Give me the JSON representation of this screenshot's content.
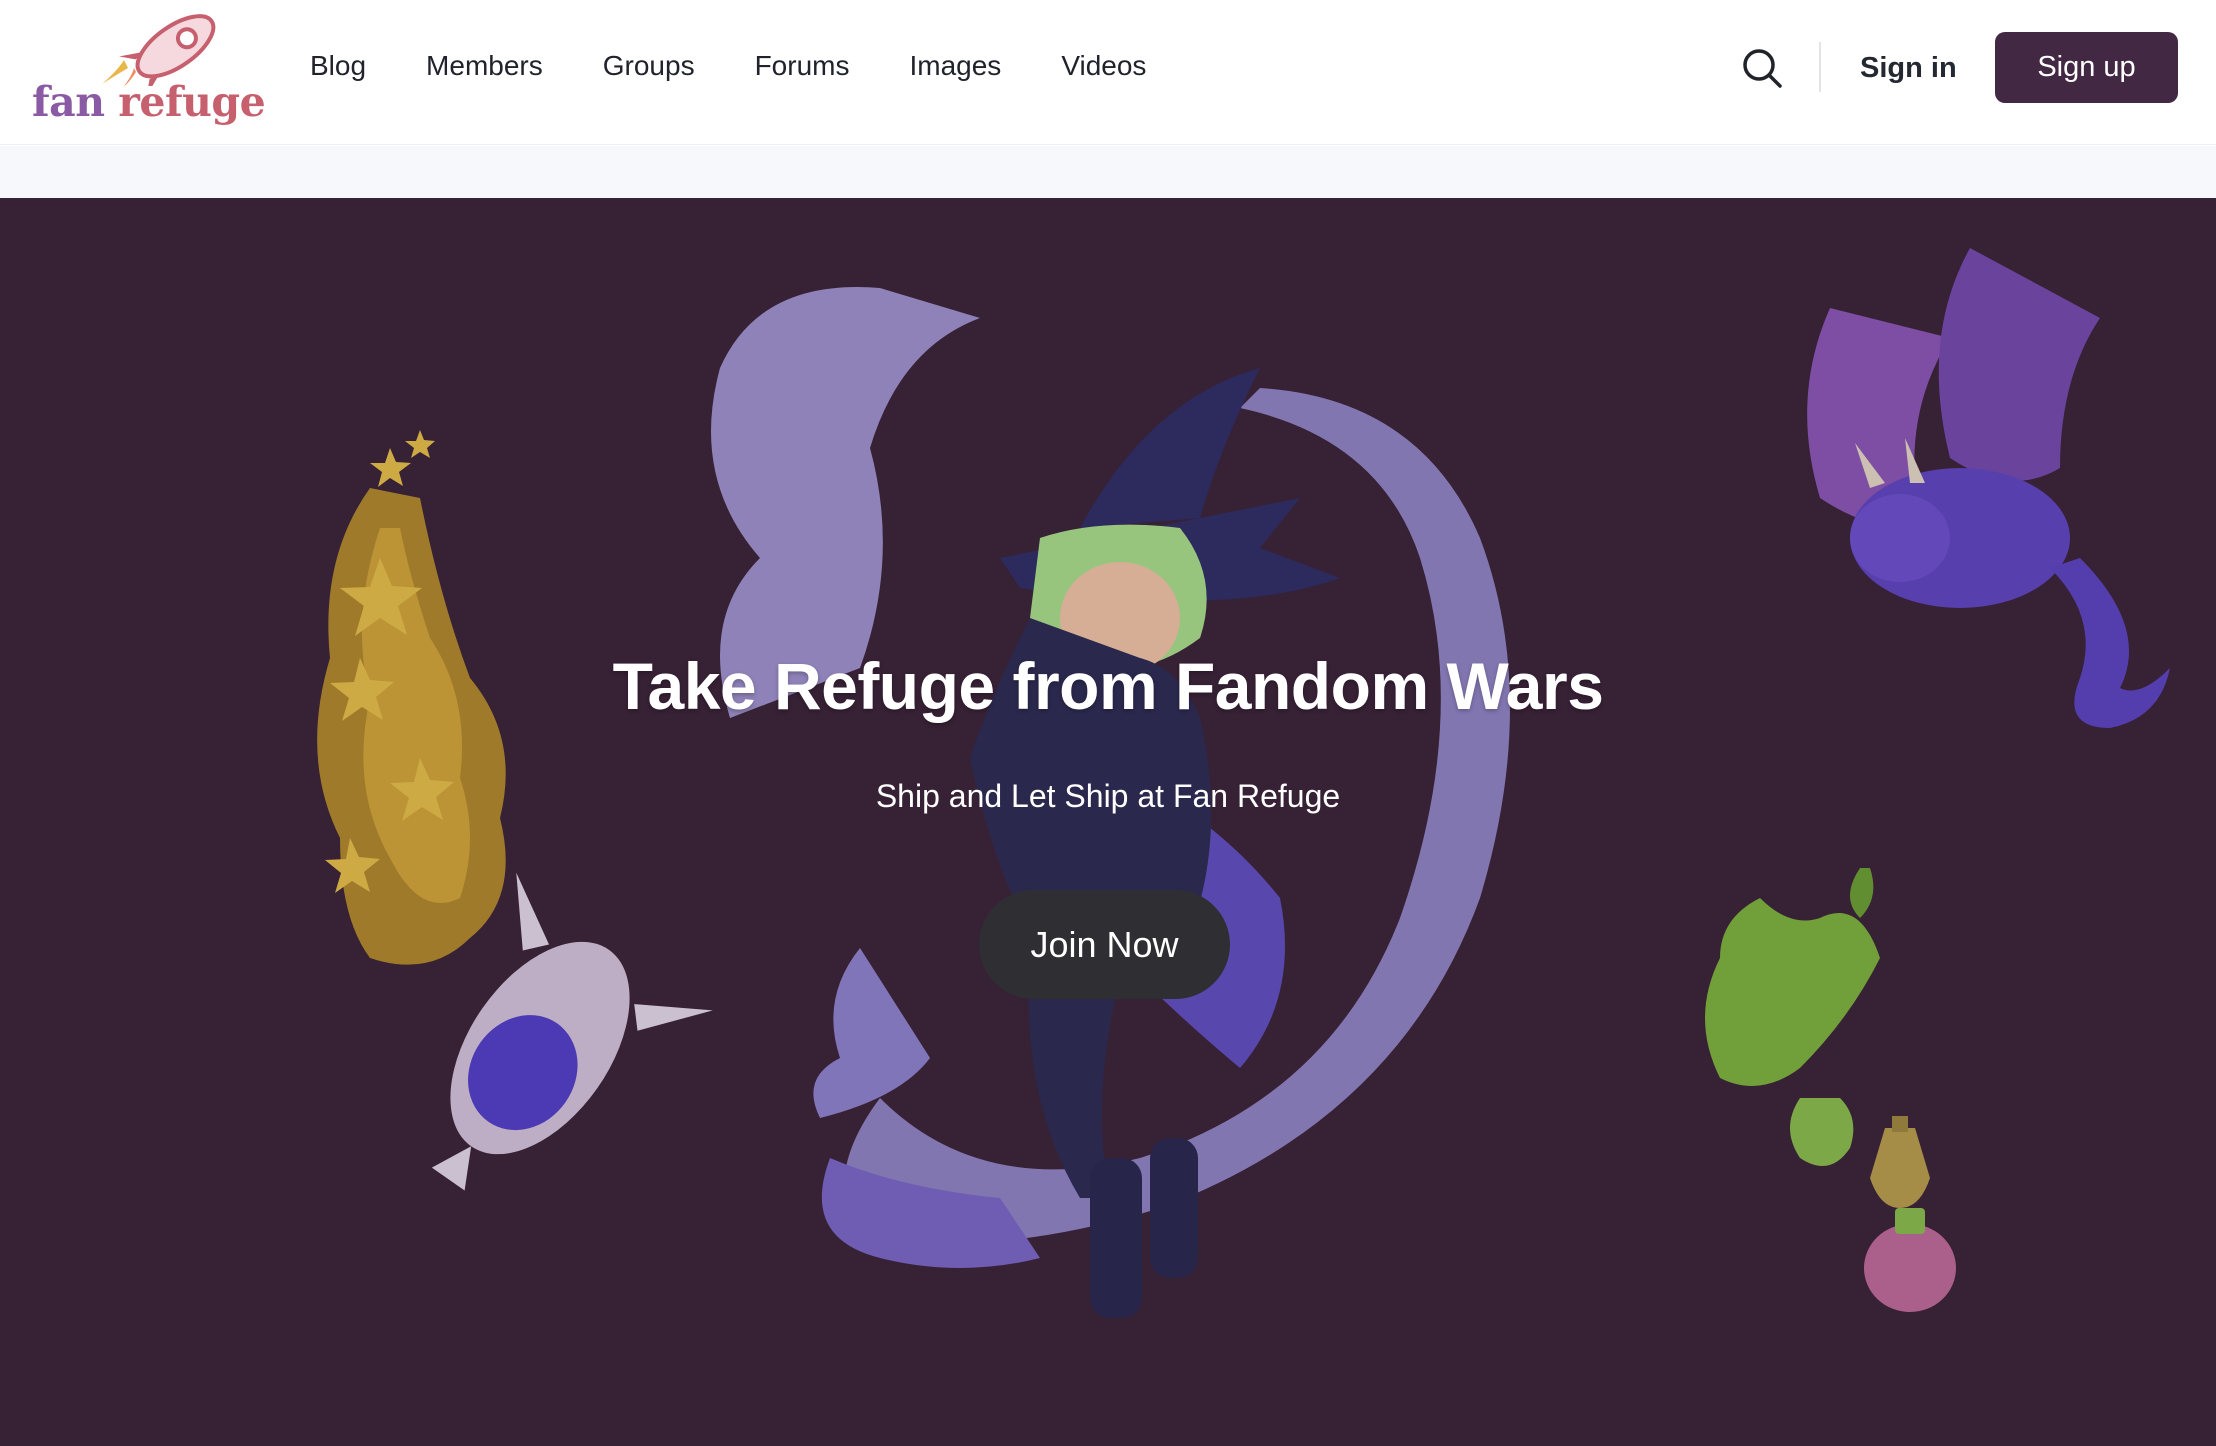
{
  "brand": {
    "logo_word1": "fan",
    "logo_word2": "refuge",
    "logo_icon": "rocket-icon",
    "colors": {
      "primary": "#432844",
      "hero_bg": "#382135",
      "logo_purple": "#8a5ba4",
      "logo_pink": "#c6606e"
    }
  },
  "nav": {
    "items": [
      {
        "label": "Blog"
      },
      {
        "label": "Members"
      },
      {
        "label": "Groups"
      },
      {
        "label": "Forums"
      },
      {
        "label": "Images"
      },
      {
        "label": "Videos"
      }
    ]
  },
  "header_actions": {
    "search_icon": "search-icon",
    "signin_label": "Sign in",
    "signup_label": "Sign up"
  },
  "hero": {
    "title": "Take Refuge from Fandom Wars",
    "subtitle": "Ship and Let Ship at Fan Refuge",
    "cta_label": "Join Now",
    "illustrations": [
      "witch-character",
      "star-rocket",
      "purple-dragon",
      "potion-bottles"
    ]
  }
}
